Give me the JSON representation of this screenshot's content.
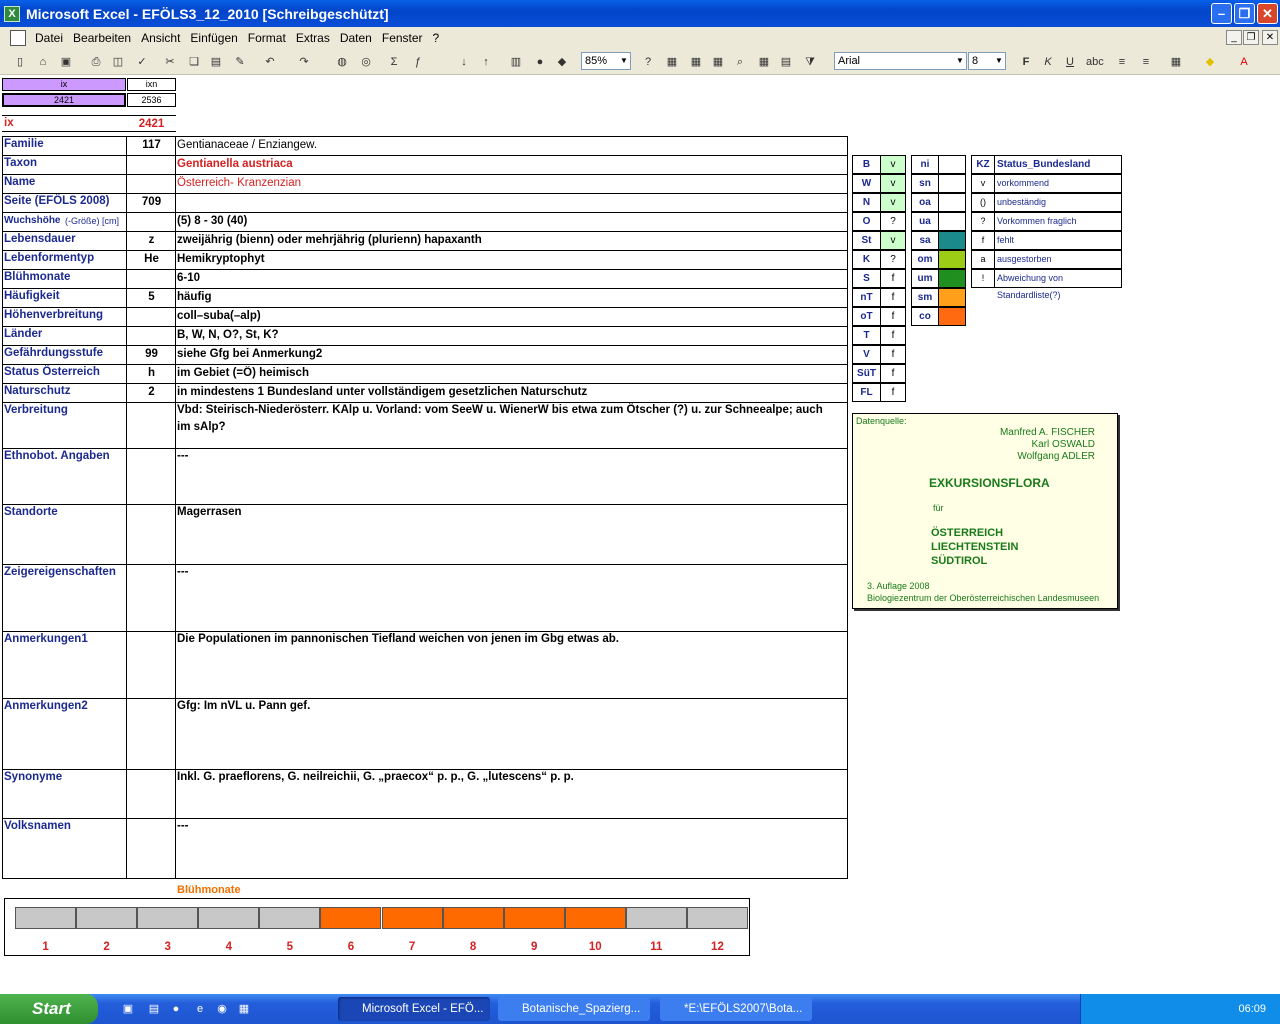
{
  "window": {
    "title": "Microsoft Excel - EFÖLS3_12_2010  [Schreibgeschützt]"
  },
  "menu": [
    "Datei",
    "Bearbeiten",
    "Ansicht",
    "Einfügen",
    "Format",
    "Extras",
    "Daten",
    "Fenster",
    "?"
  ],
  "toolbar": {
    "zoom": "85%",
    "font": "Arial",
    "size": "8"
  },
  "idbox": {
    "h1": "ix",
    "h2": "ixn",
    "v1": "2421",
    "v2": "2536"
  },
  "ix": {
    "label": "ix",
    "value": "2421"
  },
  "rows": [
    {
      "label": "Familie",
      "code": "117",
      "value": "Gentianaceae / Enziangew."
    },
    {
      "label": "Taxon",
      "code": "",
      "value": "Gentianella austriaca"
    },
    {
      "label": "Name",
      "code": "",
      "value": "Österreich- Kranzenzian"
    },
    {
      "label": "Seite (EFÖLS 2008)",
      "code": "709",
      "value": ""
    },
    {
      "label": "Wuchshöhe",
      "label_small": "(-Größe) [cm]",
      "code": "",
      "value": "(5) 8 - 30 (40)"
    },
    {
      "label": "Lebensdauer",
      "code": "z",
      "value": "zweijährig (bienn) oder mehrjährig (plurienn) hapaxanth"
    },
    {
      "label": "Lebenformentyp",
      "code": "He",
      "value": "Hemikryptophyt"
    },
    {
      "label": "Blühmonate",
      "code": "",
      "value": "6-10"
    },
    {
      "label": "Häufigkeit",
      "code": "5",
      "value": "häufig"
    },
    {
      "label": "Höhenverbreitung",
      "code": "",
      "value": "coll–suba(–alp)"
    },
    {
      "label": "Länder",
      "code": "",
      "value": "B, W, N, O?, St, K?"
    },
    {
      "label": "Gefährdungsstufe",
      "code": "99",
      "value": "siehe Gfg bei Anmerkung2"
    },
    {
      "label": "Status Österreich",
      "code": "h",
      "value": "im Gebiet (=Ö) heimisch"
    },
    {
      "label": "Naturschutz",
      "code": "2",
      "value": "in mindestens 1 Bundesland unter vollständigem gesetzlichen Naturschutz"
    }
  ],
  "big": [
    {
      "label": "Verbreitung",
      "v1": "Vbd: Steirisch-Niederösterr. KAlp u. Vorland: vom SeeW u. WienerW bis etwa zum Ötscher (?) u. zur Schneealpe; auch",
      "v2": "im sAlp?"
    },
    {
      "label": "Ethnobot. Angaben",
      "v1": "---"
    },
    {
      "label": "Standorte",
      "v1": "Magerrasen"
    },
    {
      "label": "Zeigereigenschaften",
      "v1": "---"
    },
    {
      "label": "Anmerkungen1",
      "v1": "Die Populationen im pannonischen Tiefland weichen von jenen im Gbg etwas ab."
    },
    {
      "label": "Anmerkungen2",
      "v1": "Gfg: Im nVL u. Pann gef."
    },
    {
      "label": "Synonyme",
      "v1": "Inkl. G. praeflorens, G. neilreichii, G. „praecox“ p. p., G. „lutescens“ p. p."
    },
    {
      "label": "Volksnamen",
      "v1": "---"
    }
  ],
  "states": [
    [
      "B",
      "v"
    ],
    [
      "W",
      "v"
    ],
    [
      "N",
      "v"
    ],
    [
      "O",
      "?"
    ],
    [
      "St",
      "v"
    ],
    [
      "K",
      "?"
    ],
    [
      "S",
      "f"
    ],
    [
      "nT",
      "f"
    ],
    [
      "oT",
      "f"
    ],
    [
      "T",
      "f"
    ],
    [
      "V",
      "f"
    ],
    [
      "SüT",
      "f"
    ],
    [
      "FL",
      "f"
    ]
  ],
  "altitude": [
    {
      "k": "ni",
      "c": ""
    },
    {
      "k": "sn",
      "c": ""
    },
    {
      "k": "oa",
      "c": ""
    },
    {
      "k": "ua",
      "c": ""
    },
    {
      "k": "sa",
      "c": "#1a8a8a"
    },
    {
      "k": "om",
      "c": "#9ccc16"
    },
    {
      "k": "um",
      "c": "#1f8f1f"
    },
    {
      "k": "sm",
      "c": "#ff9f1a"
    },
    {
      "k": "co",
      "c": "#ff6a10"
    }
  ],
  "legend": {
    "h1": "KZ",
    "h2": "Status_Bundesland",
    "items": [
      [
        "v",
        "vorkommend"
      ],
      [
        "()",
        "unbeständig"
      ],
      [
        "?",
        "Vorkommen fraglich"
      ],
      [
        "f",
        "fehlt"
      ],
      [
        "a",
        "ausgestorben"
      ],
      [
        "!",
        "Abweichung von Standardliste(?)"
      ]
    ]
  },
  "source": {
    "label": "Datenquelle:",
    "a1": "Manfred A. FISCHER",
    "a2": "Karl OSWALD",
    "a3": "Wolfgang ADLER",
    "title": "EXKURSIONSFLORA",
    "fuer": "für",
    "c1": "ÖSTERREICH",
    "c2": "LIECHTENSTEIN",
    "c3": "SÜDTIROL",
    "ed": "3. Auflage 2008",
    "pub": "Biologiezentrum der Oberösterreichischen Landesmuseen"
  },
  "bloom": {
    "title": "Blühmonate",
    "months": [
      "1",
      "2",
      "3",
      "4",
      "5",
      "6",
      "7",
      "8",
      "9",
      "10",
      "11",
      "12"
    ],
    "active": [
      6,
      7,
      8,
      9,
      10
    ],
    "on": "#ff6a00",
    "off": "#c8c8c8"
  },
  "taskbar": {
    "start": "Start",
    "t1": "Microsoft Excel - EFÖ...",
    "t2": "Botanische_Spazierg...",
    "t3": "*E:\\EFÖLS2007\\Bota...",
    "clock": "06:09"
  }
}
